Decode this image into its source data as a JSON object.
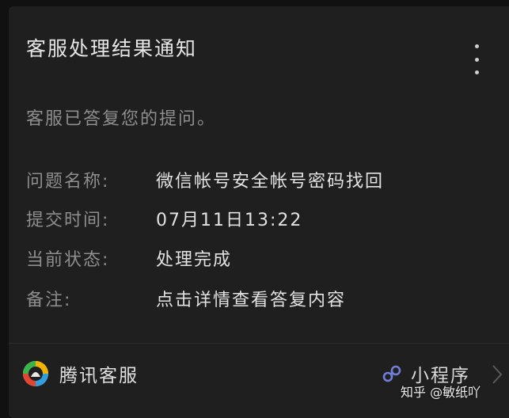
{
  "card": {
    "title": "客服处理结果通知",
    "description": "客服已答复您的提问。",
    "fields": [
      {
        "label": "问题名称:",
        "value": "微信帐号安全帐号密码找回"
      },
      {
        "label": "提交时间:",
        "value": "07月11日13:22"
      },
      {
        "label": "当前状态:",
        "value": "处理完成"
      },
      {
        "label": "备注:",
        "value": "点击详情查看答复内容"
      }
    ]
  },
  "footer": {
    "brand_name": "腾讯客服",
    "mini_program_label": "小程序"
  },
  "watermark": "知乎 @敏纸吖",
  "icons": {
    "more": "more-vertical-icon",
    "logo": "tencent-service-logo-icon",
    "mini_program": "mini-program-icon",
    "chevron": "chevron-right-icon"
  },
  "colors": {
    "background": "#111111",
    "card": "#1f1f1f",
    "primary_text": "#e6e6e6",
    "secondary_text": "#8e8e8e",
    "mini_program_accent": "#6f7fd6"
  }
}
